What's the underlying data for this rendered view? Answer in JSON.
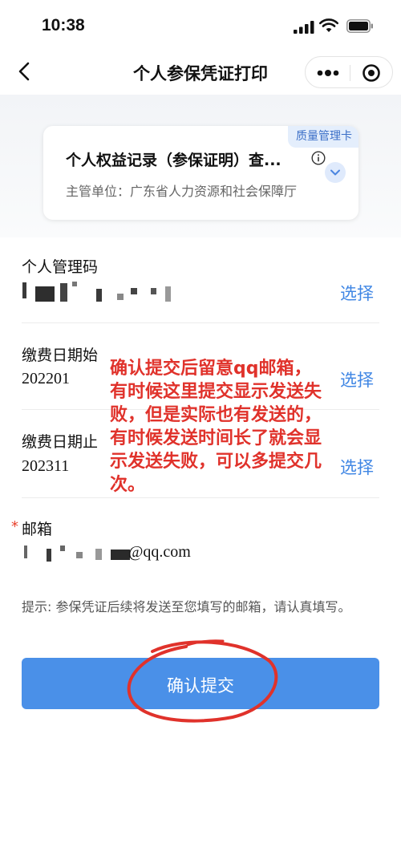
{
  "status_bar": {
    "time": "10:38"
  },
  "nav": {
    "title": "个人参保凭证打印"
  },
  "card": {
    "tag": "质量管理卡",
    "name": "个人权益记录（参保证明）查...",
    "dept": "主管单位：广东省人力资源和社会保障厅"
  },
  "form": {
    "management_code": {
      "label": "个人管理码",
      "choose": "选择"
    },
    "start_date": {
      "label": "缴费日期始",
      "value": "202201",
      "choose": "选择"
    },
    "end_date": {
      "label": "缴费日期止",
      "value": "202311",
      "choose": "选择"
    },
    "email": {
      "required_mark": "*",
      "label": "邮箱",
      "value_suffix": "@qq.com"
    }
  },
  "annotation": "确认提交后留意qq邮箱，有时候这里提交显示发送失败，但是实际也有发送的，有时候发送时间长了就会显示发送失败，可以多提交几次。",
  "tip": "提示: 参保凭证后续将发送至您填写的邮箱，请认真填写。",
  "submit_label": "确认提交",
  "colors": {
    "accent": "#4a90e8",
    "link": "#3f86e4",
    "annotation": "#e0322b"
  }
}
